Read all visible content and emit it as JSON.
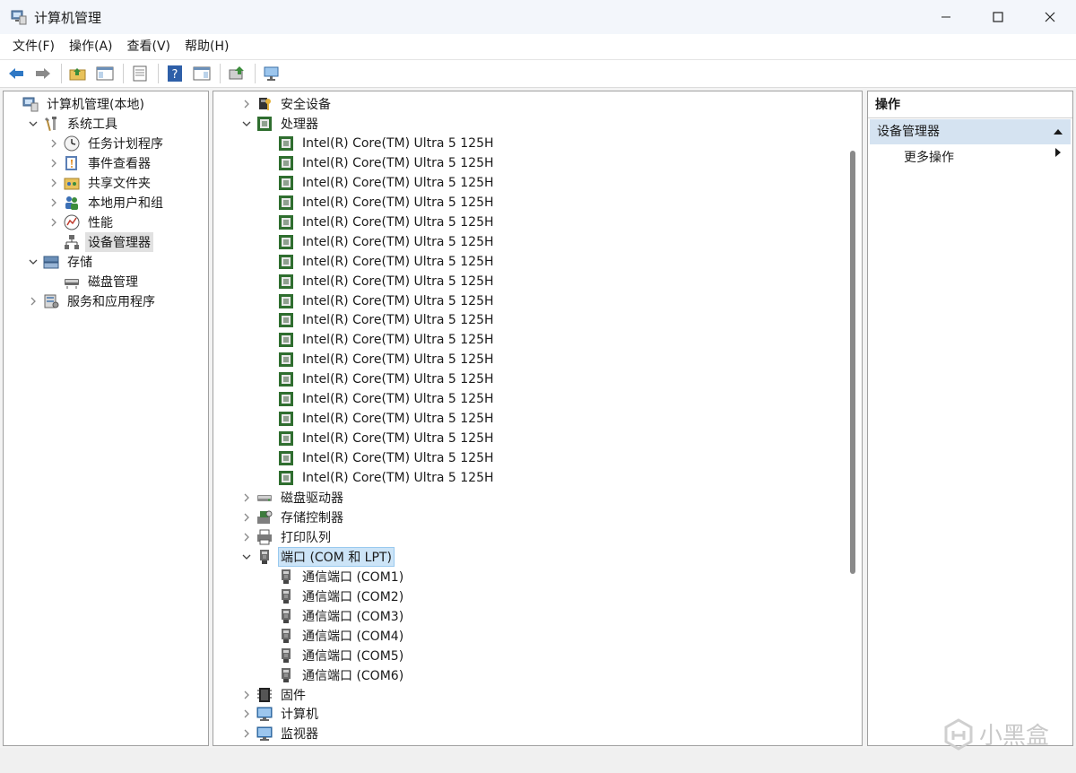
{
  "window": {
    "title": "计算机管理"
  },
  "menu": [
    "文件(F)",
    "操作(A)",
    "查看(V)",
    "帮助(H)"
  ],
  "left_tree": [
    {
      "label": "计算机管理(本地)",
      "depth": 0,
      "exp": "none",
      "icon": "computer-management-icon"
    },
    {
      "label": "系统工具",
      "depth": 1,
      "exp": "open",
      "icon": "tools-icon"
    },
    {
      "label": "任务计划程序",
      "depth": 2,
      "exp": "closed",
      "icon": "clock-icon"
    },
    {
      "label": "事件查看器",
      "depth": 2,
      "exp": "closed",
      "icon": "event-viewer-icon"
    },
    {
      "label": "共享文件夹",
      "depth": 2,
      "exp": "closed",
      "icon": "shared-folder-icon"
    },
    {
      "label": "本地用户和组",
      "depth": 2,
      "exp": "closed",
      "icon": "users-icon"
    },
    {
      "label": "性能",
      "depth": 2,
      "exp": "closed",
      "icon": "performance-icon"
    },
    {
      "label": "设备管理器",
      "depth": 2,
      "exp": "none",
      "icon": "device-manager-icon",
      "selected": true
    },
    {
      "label": "存储",
      "depth": 1,
      "exp": "open",
      "icon": "storage-icon"
    },
    {
      "label": "磁盘管理",
      "depth": 2,
      "exp": "none",
      "icon": "disk-icon"
    },
    {
      "label": "服务和应用程序",
      "depth": 1,
      "exp": "closed",
      "icon": "services-icon"
    }
  ],
  "device_tree": [
    {
      "label": "安全设备",
      "depth": 0,
      "exp": "closed",
      "icon": "security-device-icon"
    },
    {
      "label": "处理器",
      "depth": 0,
      "exp": "open",
      "icon": "processor-icon"
    },
    {
      "label": "Intel(R) Core(TM) Ultra 5 125H",
      "depth": 1,
      "exp": "none",
      "icon": "processor-icon"
    },
    {
      "label": "Intel(R) Core(TM) Ultra 5 125H",
      "depth": 1,
      "exp": "none",
      "icon": "processor-icon"
    },
    {
      "label": "Intel(R) Core(TM) Ultra 5 125H",
      "depth": 1,
      "exp": "none",
      "icon": "processor-icon"
    },
    {
      "label": "Intel(R) Core(TM) Ultra 5 125H",
      "depth": 1,
      "exp": "none",
      "icon": "processor-icon"
    },
    {
      "label": "Intel(R) Core(TM) Ultra 5 125H",
      "depth": 1,
      "exp": "none",
      "icon": "processor-icon"
    },
    {
      "label": "Intel(R) Core(TM) Ultra 5 125H",
      "depth": 1,
      "exp": "none",
      "icon": "processor-icon"
    },
    {
      "label": "Intel(R) Core(TM) Ultra 5 125H",
      "depth": 1,
      "exp": "none",
      "icon": "processor-icon"
    },
    {
      "label": "Intel(R) Core(TM) Ultra 5 125H",
      "depth": 1,
      "exp": "none",
      "icon": "processor-icon"
    },
    {
      "label": "Intel(R) Core(TM) Ultra 5 125H",
      "depth": 1,
      "exp": "none",
      "icon": "processor-icon"
    },
    {
      "label": "Intel(R) Core(TM) Ultra 5 125H",
      "depth": 1,
      "exp": "none",
      "icon": "processor-icon"
    },
    {
      "label": "Intel(R) Core(TM) Ultra 5 125H",
      "depth": 1,
      "exp": "none",
      "icon": "processor-icon"
    },
    {
      "label": "Intel(R) Core(TM) Ultra 5 125H",
      "depth": 1,
      "exp": "none",
      "icon": "processor-icon"
    },
    {
      "label": "Intel(R) Core(TM) Ultra 5 125H",
      "depth": 1,
      "exp": "none",
      "icon": "processor-icon"
    },
    {
      "label": "Intel(R) Core(TM) Ultra 5 125H",
      "depth": 1,
      "exp": "none",
      "icon": "processor-icon"
    },
    {
      "label": "Intel(R) Core(TM) Ultra 5 125H",
      "depth": 1,
      "exp": "none",
      "icon": "processor-icon"
    },
    {
      "label": "Intel(R) Core(TM) Ultra 5 125H",
      "depth": 1,
      "exp": "none",
      "icon": "processor-icon"
    },
    {
      "label": "Intel(R) Core(TM) Ultra 5 125H",
      "depth": 1,
      "exp": "none",
      "icon": "processor-icon"
    },
    {
      "label": "Intel(R) Core(TM) Ultra 5 125H",
      "depth": 1,
      "exp": "none",
      "icon": "processor-icon"
    },
    {
      "label": "磁盘驱动器",
      "depth": 0,
      "exp": "closed",
      "icon": "disk-drive-icon"
    },
    {
      "label": "存储控制器",
      "depth": 0,
      "exp": "closed",
      "icon": "storage-controller-icon"
    },
    {
      "label": "打印队列",
      "depth": 0,
      "exp": "closed",
      "icon": "printer-icon"
    },
    {
      "label": "端口 (COM 和 LPT)",
      "depth": 0,
      "exp": "open",
      "icon": "port-icon",
      "focused": true
    },
    {
      "label": "通信端口 (COM1)",
      "depth": 1,
      "exp": "none",
      "icon": "port-icon"
    },
    {
      "label": "通信端口 (COM2)",
      "depth": 1,
      "exp": "none",
      "icon": "port-icon"
    },
    {
      "label": "通信端口 (COM3)",
      "depth": 1,
      "exp": "none",
      "icon": "port-icon"
    },
    {
      "label": "通信端口 (COM4)",
      "depth": 1,
      "exp": "none",
      "icon": "port-icon"
    },
    {
      "label": "通信端口 (COM5)",
      "depth": 1,
      "exp": "none",
      "icon": "port-icon"
    },
    {
      "label": "通信端口 (COM6)",
      "depth": 1,
      "exp": "none",
      "icon": "port-icon"
    },
    {
      "label": "固件",
      "depth": 0,
      "exp": "closed",
      "icon": "firmware-icon"
    },
    {
      "label": "计算机",
      "depth": 0,
      "exp": "closed",
      "icon": "monitor-icon"
    },
    {
      "label": "监视器",
      "depth": 0,
      "exp": "closed",
      "icon": "monitor-icon"
    }
  ],
  "actions": {
    "header": "操作",
    "group": "设备管理器",
    "more": "更多操作"
  },
  "watermark": "小黑盒",
  "colors": {
    "selection": "#cce4f7",
    "actions_group": "#d5e3f1",
    "accent_blue": "#2f78c4"
  }
}
